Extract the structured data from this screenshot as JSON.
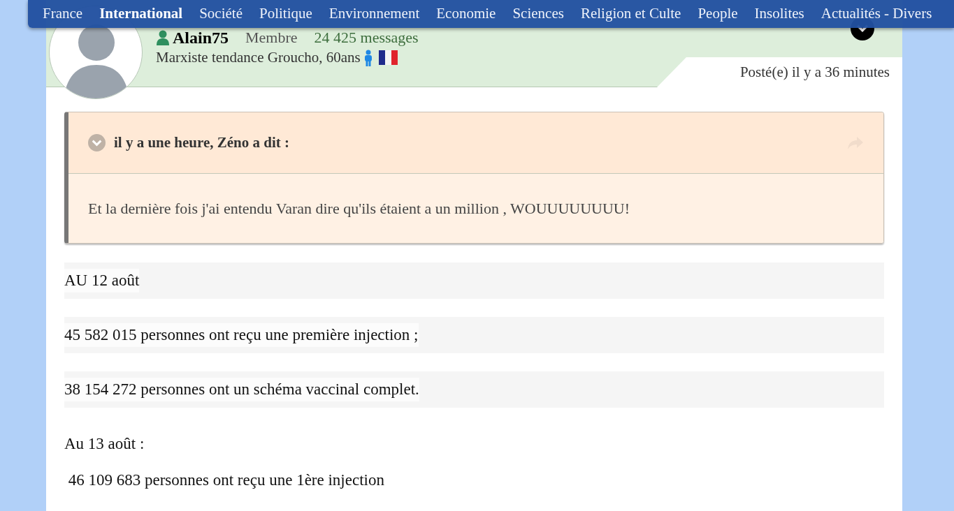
{
  "nav": [
    {
      "label": "France",
      "selected": false
    },
    {
      "label": "International",
      "selected": true
    },
    {
      "label": "Société",
      "selected": false
    },
    {
      "label": "Politique",
      "selected": false
    },
    {
      "label": "Environnement",
      "selected": false
    },
    {
      "label": "Economie",
      "selected": false
    },
    {
      "label": "Sciences",
      "selected": false
    },
    {
      "label": "Religion et Culte",
      "selected": false
    },
    {
      "label": "People",
      "selected": false
    },
    {
      "label": "Insolites",
      "selected": false
    },
    {
      "label": "Actualités - Divers",
      "selected": false
    }
  ],
  "author": {
    "name": "Alain75",
    "rank": "Membre",
    "messages": "24 425 messages",
    "tagline": "Marxiste tendance Groucho, 60ans"
  },
  "posted": "Posté(e) il y a 36 minutes",
  "quote": {
    "header": "il y a une heure, Zéno a dit :",
    "body": "Et la dernière fois j'ai entendu Varan dire qu'ils étaient a un million , WOUUUUUUUU!"
  },
  "paragraphs": [
    {
      "text": "AU 12 août",
      "kind": "highlighted"
    },
    {
      "text": "45 582 015 personnes ont reçu une première injection ;",
      "kind": "highlighted"
    },
    {
      "text": "38 154 272 personnes ont un schéma vaccinal complet.",
      "kind": "highlighted"
    },
    {
      "text": "Au 13 août :",
      "kind": "plain"
    },
    {
      "text": " 46 109 683 personnes ont reçu une 1ère injection",
      "kind": "plain"
    }
  ]
}
